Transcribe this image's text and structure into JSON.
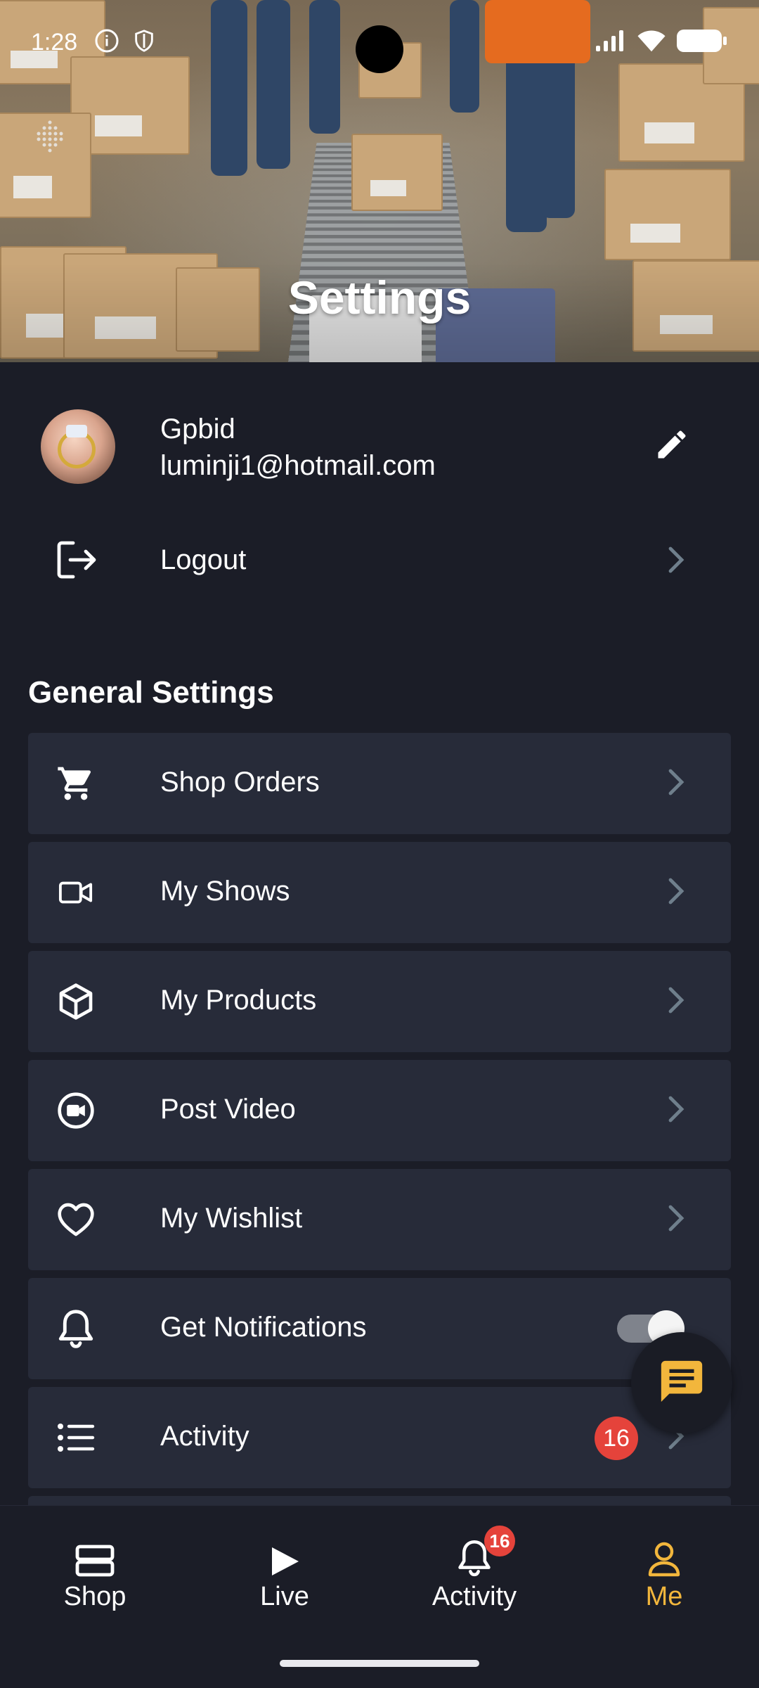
{
  "status_bar": {
    "time": "1:28",
    "icons_left": [
      "info-icon",
      "shield-icon"
    ],
    "icons_right": [
      "signal-icon",
      "wifi-icon",
      "battery-icon"
    ]
  },
  "header": {
    "title": "Settings",
    "background": "warehouse-photo"
  },
  "profile": {
    "name": "Gpbid",
    "email": "luminji1@hotmail.com",
    "edit_icon": "pencil-icon"
  },
  "logout": {
    "label": "Logout"
  },
  "general_settings": {
    "title": "General Settings",
    "items": [
      {
        "label": "Shop Orders",
        "icon": "cart-icon",
        "control": "chevron"
      },
      {
        "label": "My Shows",
        "icon": "video-camera-icon",
        "control": "chevron"
      },
      {
        "label": "My Products",
        "icon": "box-icon",
        "control": "chevron"
      },
      {
        "label": "Post Video",
        "icon": "record-video-icon",
        "control": "chevron"
      },
      {
        "label": "My Wishlist",
        "icon": "heart-icon",
        "control": "chevron"
      },
      {
        "label": "Get Notifications",
        "icon": "bell-icon",
        "control": "toggle",
        "toggle_on": true
      },
      {
        "label": "Activity",
        "icon": "list-icon",
        "control": "badge",
        "badge": "16"
      }
    ]
  },
  "bottom_nav": {
    "items": [
      {
        "label": "Shop",
        "icon": "shop-icon",
        "active": false
      },
      {
        "label": "Live",
        "icon": "play-icon",
        "active": false
      },
      {
        "label": "Activity",
        "icon": "bell-icon",
        "active": false,
        "badge": "16"
      },
      {
        "label": "Me",
        "icon": "person-icon",
        "active": true
      }
    ]
  },
  "colors": {
    "background": "#1b1d27",
    "row_background": "#272b39",
    "accent": "#f2b63c",
    "badge": "#e5433b",
    "chevron": "#6f7f8c"
  }
}
